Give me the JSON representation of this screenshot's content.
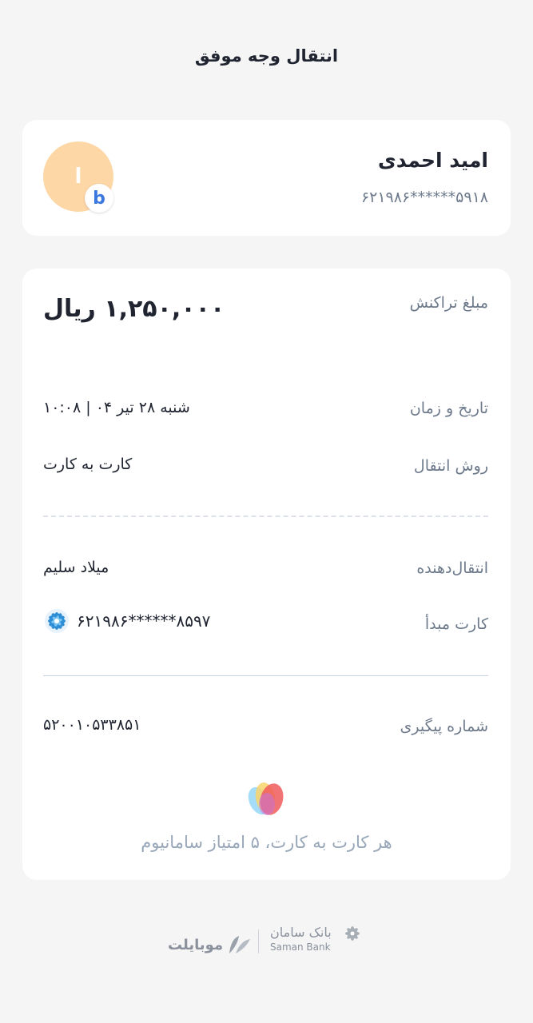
{
  "header": {
    "title": "انتقال وجه موفق"
  },
  "recipient": {
    "avatar_initial": "ا",
    "bank_badge_letter": "b",
    "name": "امید احمدی",
    "card_number": "۶۲۱۹۸۶******۵۹۱۸"
  },
  "transaction": {
    "amount_label": "مبلغ تراکنش",
    "amount_value": "۱,۲۵۰,۰۰۰ ریال",
    "datetime_label": "تاریخ و زمان",
    "datetime_value": "شنبه ۲۸ تیر ۰۴ | ۱۰:۰۸",
    "method_label": "روش انتقال",
    "method_value": "کارت به کارت",
    "sender_label": "انتقال‌دهنده",
    "sender_value": "میلاد سلیم",
    "source_card_label": "کارت مبدأ",
    "source_card_value": "۶۲۱۹۸۶******۸۵۹۷",
    "tracking_label": "شماره پیگیری",
    "tracking_value": "۵۲۰۰۱۰۵۳۳۸۵۱"
  },
  "promo": {
    "text": "هر کارت به کارت، ۵ امتیاز سامانیوم"
  },
  "footer": {
    "mobilet_name": "موبایلت",
    "bank_name_fa": "بانک سامان",
    "bank_name_en": "Saman Bank"
  },
  "colors": {
    "avatar": "#fdd7a6",
    "bank_badge": "#3a78e0",
    "muted_text": "#6d7a8c",
    "promo_text": "#97a6b8"
  }
}
